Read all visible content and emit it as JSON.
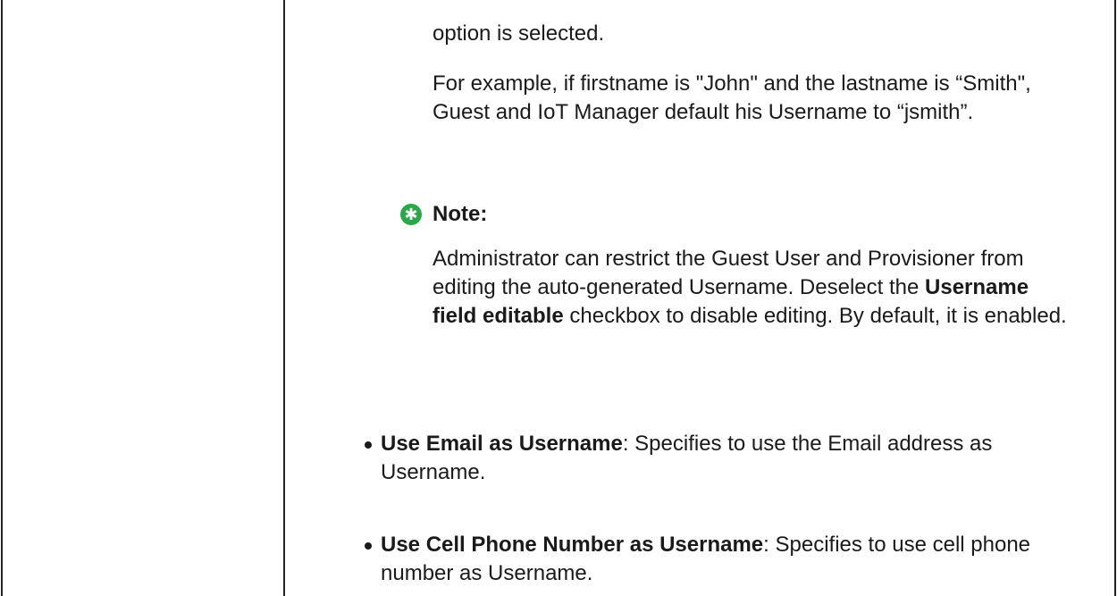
{
  "fragment": {
    "continued_text": "option is selected.",
    "example": "For example, if firstname is \"John\" and the lastname is “Smith\", Guest and IoT Manager default his Username to “jsmith”."
  },
  "note": {
    "icon": "note-star-icon",
    "label": "Note:",
    "body_before": "Administrator can restrict the Guest User and Provisioner from editing the auto-generated Username. Deselect the ",
    "body_bold": "Username field editable",
    "body_after": " checkbox to disable editing. By default, it is enabled.",
    "icon_color": "#2aa84a"
  },
  "bullets": [
    {
      "term": "Use Email as Username",
      "desc": ": Specifies to use the Email address as Username."
    },
    {
      "term": "Use Cell Phone Number as Username",
      "desc": ": Specifies to use cell phone number as Username."
    }
  ]
}
